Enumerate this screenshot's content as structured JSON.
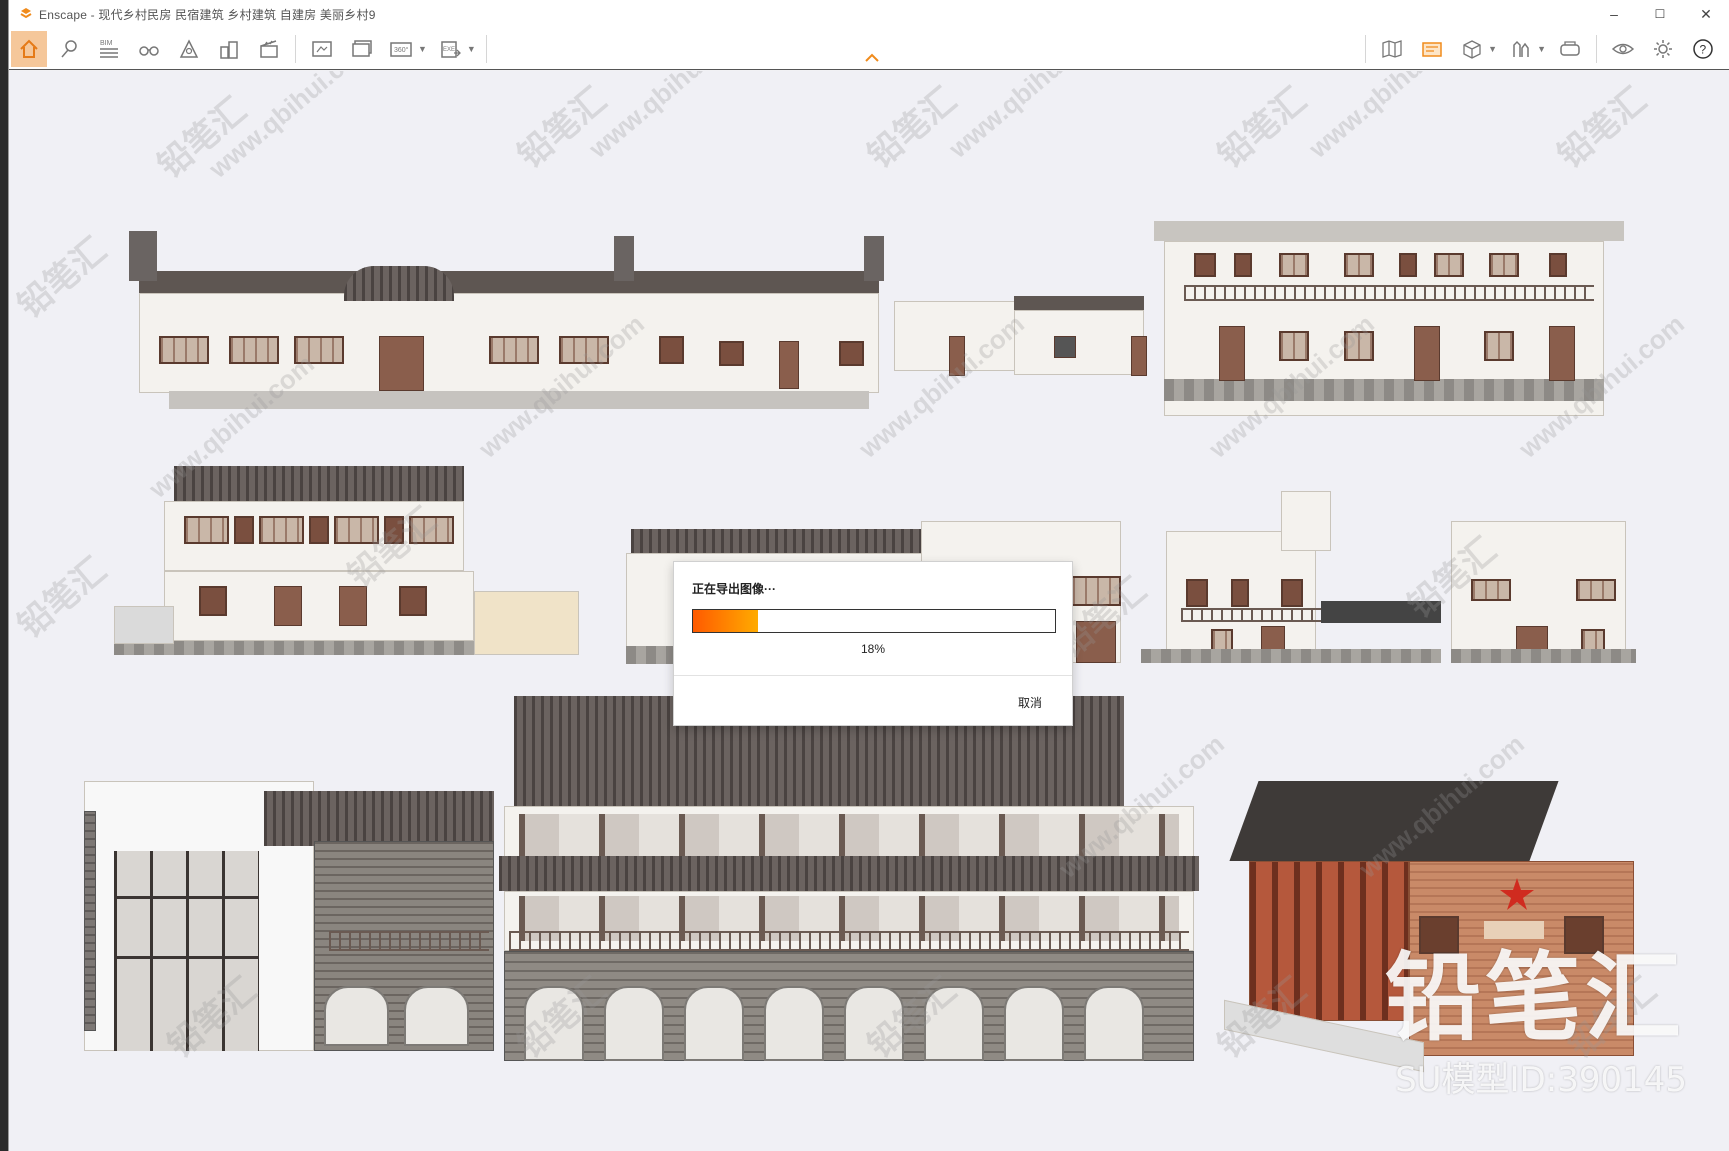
{
  "window": {
    "title": "Enscape - 现代乡村民房 民宿建筑 乡村建筑 自建房 美丽乡村9",
    "controls": {
      "minimize": "–",
      "maximize": "☐",
      "close": "✕"
    }
  },
  "toolbar": {
    "left_icons": [
      "home-icon",
      "pin-icon",
      "bim-icon",
      "binoculars-icon",
      "sun-icon",
      "buildings-icon",
      "clapper-icon",
      "screenshot-icon",
      "batch-render-icon",
      "panorama-icon",
      "exe-export-icon"
    ],
    "bim_label": "BIM",
    "panorama_label": "360°",
    "exe_label": "EXE",
    "right_icons": [
      "map-icon",
      "capture-icon",
      "cube-icon",
      "asset-library-icon",
      "vr-headset-icon",
      "eye-icon",
      "settings-icon",
      "help-icon"
    ],
    "help_label": "?",
    "accent_color": "#f08b1c"
  },
  "dialog": {
    "title": "正在导出图像···",
    "progress": 0.18,
    "progress_text": "18%",
    "cancel_label": "取消"
  },
  "watermarks": {
    "cn": "铅笔汇",
    "url": "www.qbihui.com"
  },
  "branding": {
    "logo_text": "铅笔汇",
    "model_id": "SU模型ID:390145"
  }
}
